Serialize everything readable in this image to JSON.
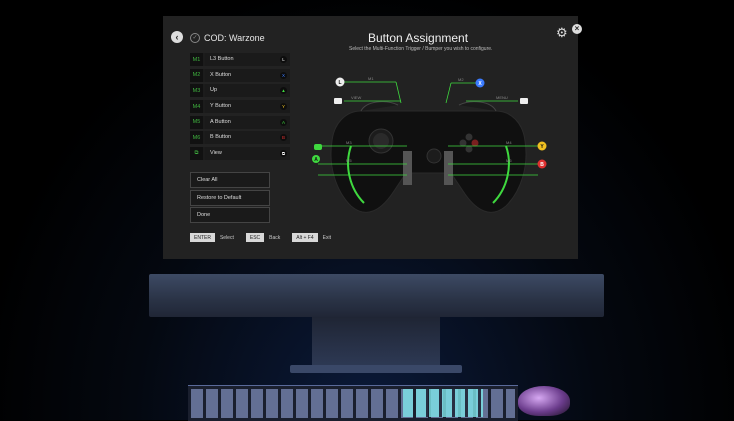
{
  "header": {
    "back_icon": "arrow-left-icon",
    "profile_check_icon": "check-circle-icon",
    "profile_name": "COD: Warzone",
    "title": "Button Assignment",
    "subtitle": "Select the Multi-Function Trigger / Bumper you wish to configure.",
    "settings_icon": "gear-icon",
    "close_icon": "close-icon"
  },
  "mappings": [
    {
      "slot": "M1",
      "label": "L3 Button",
      "icon": "L",
      "icon_color": "#ffffff"
    },
    {
      "slot": "M2",
      "label": "X Button",
      "icon": "X",
      "icon_color": "#3a7bff"
    },
    {
      "slot": "M3",
      "label": "Up",
      "icon": "▲",
      "icon_color": "#3fd93f"
    },
    {
      "slot": "M4",
      "label": "Y Button",
      "icon": "Y",
      "icon_color": "#f0c020"
    },
    {
      "slot": "M5",
      "label": "A Button",
      "icon": "A",
      "icon_color": "#3fd93f"
    },
    {
      "slot": "M6",
      "label": "B Button",
      "icon": "B",
      "icon_color": "#e03030"
    },
    {
      "slot": "⧉",
      "label": "View",
      "icon": "⧉",
      "icon_color": "#ffffff"
    }
  ],
  "actions": {
    "clear_all": "Clear All",
    "restore_default": "Restore to Default",
    "done": "Done"
  },
  "hints": [
    {
      "key": "ENTER",
      "label": "Select"
    },
    {
      "key": "ESC",
      "label": "Back"
    },
    {
      "key": "Alt + F4",
      "label": "Exit"
    }
  ],
  "controller_callouts": {
    "M1": "M1",
    "M2": "M2",
    "M3": "M3",
    "M4": "M4",
    "M5": "M5",
    "M6": "M6",
    "VIEW": "VIEW",
    "MENU": "MENU",
    "left_top": "L",
    "right_top": "X",
    "right_mid": "Y",
    "right_bottom": "B",
    "left_bottom": "A"
  },
  "colors": {
    "accent_green": "#3fd93f",
    "screen_bg": "#222222"
  }
}
